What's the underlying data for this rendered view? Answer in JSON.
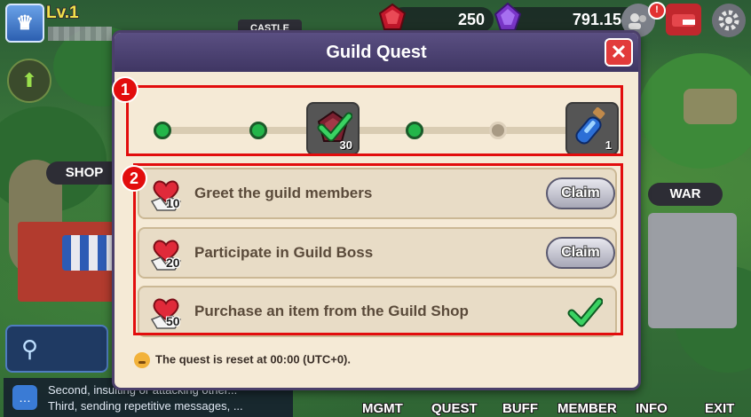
{
  "hud": {
    "rank_icon": "crown-shield-icon",
    "level": "Lv.1",
    "castle_label": "CASTLE",
    "gems": "250",
    "crystals": "791.150",
    "map_labels": {
      "shop": "SHOP",
      "war": "WAR"
    }
  },
  "modal": {
    "title": "Guild Quest",
    "close_icon": "close-icon"
  },
  "progress": {
    "milestones": [
      {
        "type": "dot",
        "state": "done"
      },
      {
        "type": "dot",
        "state": "done"
      },
      {
        "type": "reward",
        "icon": "ruby-gem-icon",
        "count": "30",
        "claimed": true
      },
      {
        "type": "dot",
        "state": "done"
      },
      {
        "type": "dot",
        "state": "pending"
      },
      {
        "type": "reward",
        "icon": "blue-potion-icon",
        "count": "1",
        "claimed": false
      }
    ]
  },
  "quests": [
    {
      "points": "10",
      "label": "Greet the guild members",
      "action": "Claim",
      "completed": false
    },
    {
      "points": "20",
      "label": "Participate in Guild Boss",
      "action": "Claim",
      "completed": false
    },
    {
      "points": "50",
      "label": "Purchase an item from the Guild Shop",
      "action": "",
      "completed": true
    }
  ],
  "reset_note": "The quest is reset at 00:00 (UTC+0).",
  "annotations": {
    "one": "1",
    "two": "2"
  },
  "chat": {
    "line1": "Second, insulting or attacking other...",
    "line2": "Third, sending repetitive messages, ..."
  },
  "bottom_menu": [
    "MGMT",
    "QUEST",
    "BUFF",
    "MEMBER",
    "INFO",
    "EXIT"
  ],
  "colors": {
    "annotation_red": "#e20d0d",
    "modal_header": "#4b3f6a",
    "done_green": "#23b64a"
  }
}
